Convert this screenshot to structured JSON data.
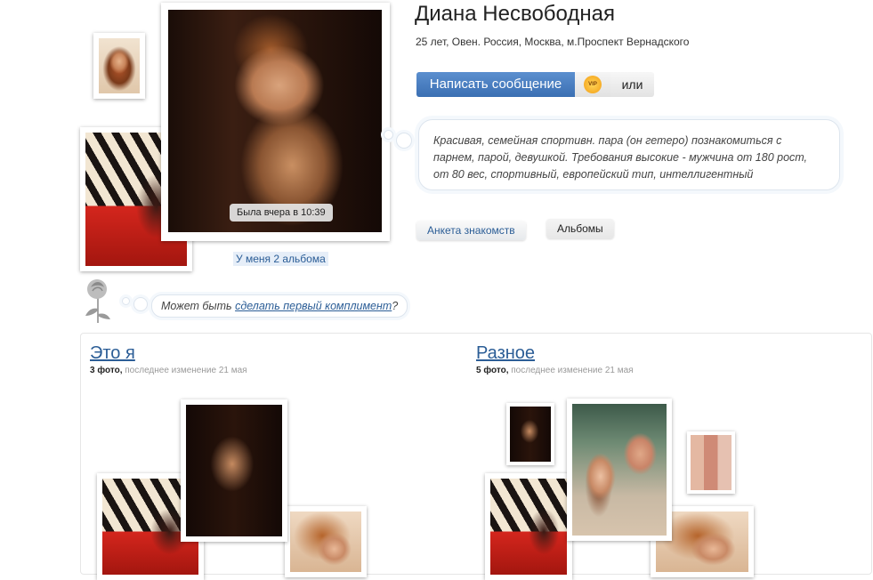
{
  "profile": {
    "name": "Диана Несвободная",
    "meta": "25 лет, Овен. Россия, Москва, м.Проспект Вернадского",
    "description": "Красивая, семейная спортивн. пара (он гетеро) познакомиться с парнем, парой, девушкой. Требования высокие - мужчина от 180 рост, от 80 вес, спортивный, европейский тип, интеллигентный",
    "status": "Была вчера в 10:39",
    "albums_link": "У меня 2 альбома"
  },
  "actions": {
    "write_message": "Написать сообщение",
    "vip_badge": "VIP",
    "or_label": "или"
  },
  "tabs": [
    {
      "label": "Анкета знакомств",
      "active": true
    },
    {
      "label": "Альбомы",
      "active": false
    }
  ],
  "compliment": {
    "prefix": "Может быть ",
    "link": "сделать первый комплимент",
    "suffix": "?"
  },
  "albums": [
    {
      "title": "Это я",
      "count": "3 фото,",
      "updated": " последнее изменение 21 мая"
    },
    {
      "title": "Разное",
      "count": "5 фото,",
      "updated": " последнее изменение 21 мая"
    }
  ],
  "colors": {
    "link": "#2b5d96",
    "button_primary": "#3b6fb3",
    "bubble_border": "#dde5ee"
  },
  "icons": {
    "rose": "rose-icon",
    "vip": "vip-badge-icon"
  }
}
